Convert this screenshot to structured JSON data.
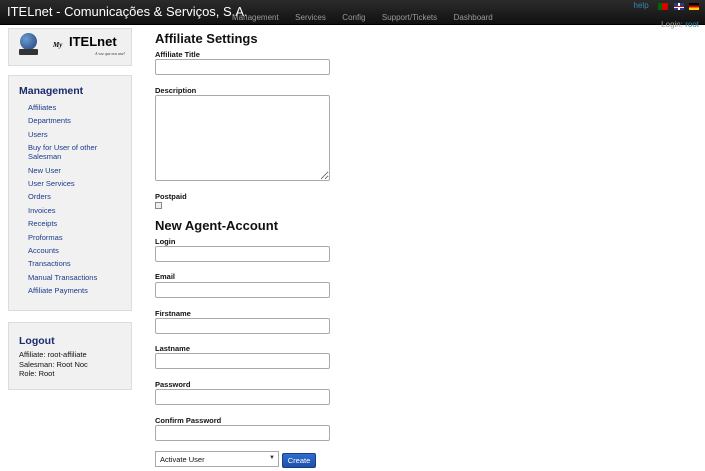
{
  "navbar": {
    "brand": "ITELnet - Comunicações & Serviços, S.A.",
    "links": [
      "Management",
      "Services",
      "Config",
      "Support/Tickets",
      "Dashboard"
    ],
    "help": "help",
    "login_label": "Login:",
    "login_user": "root"
  },
  "logo": {
    "my": "My",
    "name": "ITELnet",
    "tagline": "A voz que nos une!"
  },
  "sidebar": {
    "management_title": "Management",
    "items": [
      "Affiliates",
      "Departments",
      "Users",
      "Buy for User of other Salesman",
      "New User",
      "User Services",
      "Orders",
      "Invoices",
      "Receipts",
      "Proformas",
      "Accounts",
      "Transactions",
      "Manual Transactions",
      "Affiliate Payments"
    ],
    "logout_title": "Logout",
    "affiliate_line": "Affiliate: root-affiliate",
    "salesman_line": "Salesman: Root Noc",
    "role_line": "Role: Root"
  },
  "form": {
    "affiliate_settings_title": "Affiliate Settings",
    "affiliate_title_label": "Affiliate Title",
    "description_label": "Description",
    "postpaid_label": "Postpaid",
    "new_agent_title": "New Agent-Account",
    "login_label": "Login",
    "email_label": "Email",
    "firstname_label": "Firstname",
    "lastname_label": "Lastname",
    "password_label": "Password",
    "confirm_password_label": "Confirm Password",
    "activate_select_value": "Activate User",
    "create_button": "Create"
  }
}
